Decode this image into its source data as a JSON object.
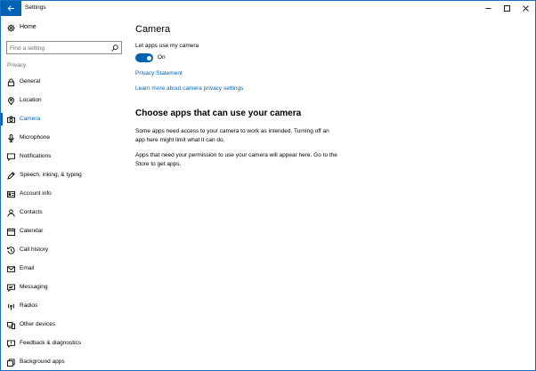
{
  "window": {
    "title": "Settings",
    "accent": "#0063b1"
  },
  "sidebar": {
    "home_label": "Home",
    "search_placeholder": "Find a setting",
    "section_label": "Privacy",
    "items": [
      {
        "label": "General",
        "icon": "lock-icon"
      },
      {
        "label": "Location",
        "icon": "location-pin-icon"
      },
      {
        "label": "Camera",
        "icon": "camera-icon",
        "active": true
      },
      {
        "label": "Microphone",
        "icon": "microphone-icon"
      },
      {
        "label": "Notifications",
        "icon": "notifications-icon"
      },
      {
        "label": "Speech, inking, & typing",
        "icon": "speech-icon"
      },
      {
        "label": "Account info",
        "icon": "account-icon"
      },
      {
        "label": "Contacts",
        "icon": "contacts-icon"
      },
      {
        "label": "Calendar",
        "icon": "calendar-icon"
      },
      {
        "label": "Call history",
        "icon": "call-history-icon"
      },
      {
        "label": "Email",
        "icon": "email-icon"
      },
      {
        "label": "Messaging",
        "icon": "messaging-icon"
      },
      {
        "label": "Radios",
        "icon": "radios-icon"
      },
      {
        "label": "Other devices",
        "icon": "other-devices-icon"
      },
      {
        "label": "Feedback & diagnostics",
        "icon": "feedback-icon"
      },
      {
        "label": "Background apps",
        "icon": "background-apps-icon"
      }
    ]
  },
  "main": {
    "title": "Camera",
    "toggle_label": "Let apps use my camera",
    "toggle_state": "On",
    "privacy_link": "Privacy Statement",
    "learn_link": "Learn more about camera privacy settings",
    "section_title": "Choose apps that can use your camera",
    "para1": "Some apps need access to your camera to work as intended. Turning off an app here might limit what it can do.",
    "para2": "Apps that need your permission to use your camera will appear here. Go to the Store to get apps."
  }
}
